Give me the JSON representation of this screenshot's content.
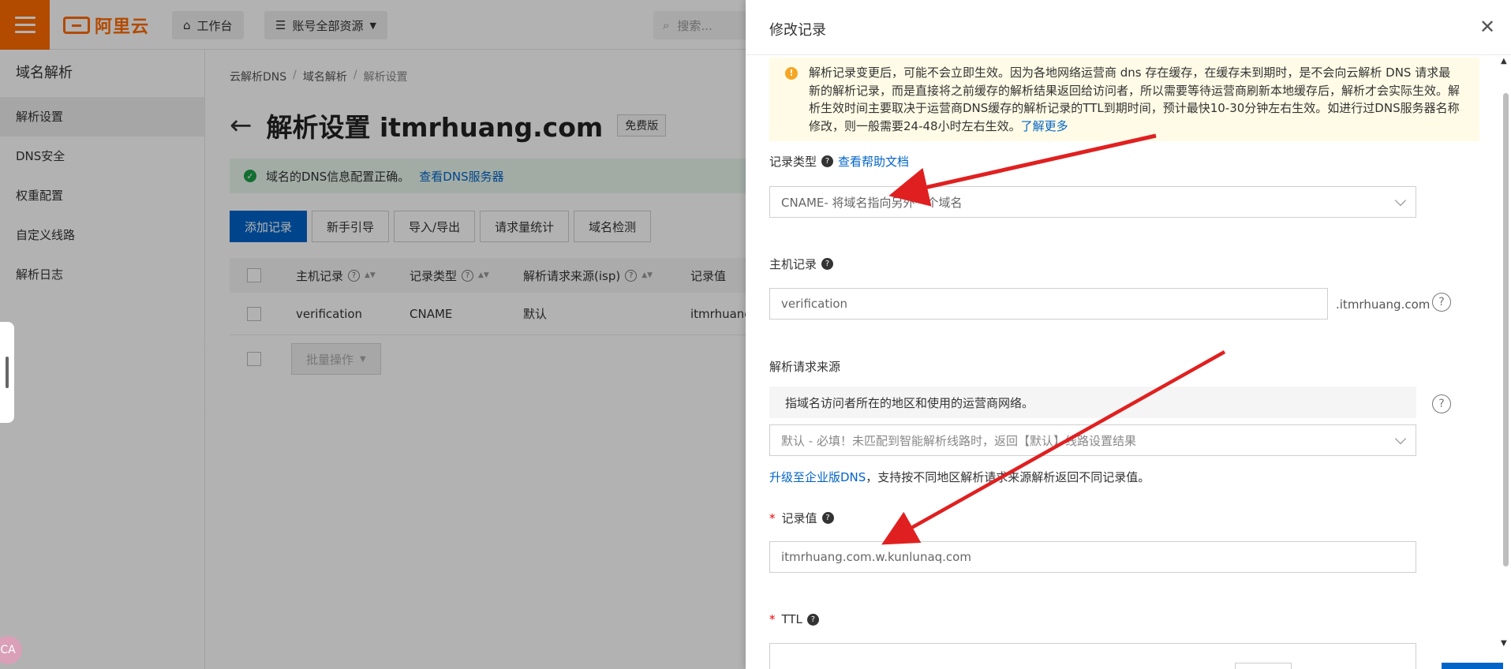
{
  "topbar": {
    "logo_text": "阿里云",
    "workbench_label": "工作台",
    "resources_label": "账号全部资源",
    "search_placeholder": "搜索..."
  },
  "sidenav": {
    "title": "域名解析",
    "items": [
      {
        "label": "解析设置",
        "active": true
      },
      {
        "label": "DNS安全",
        "active": false
      },
      {
        "label": "权重配置",
        "active": false
      },
      {
        "label": "自定义线路",
        "active": false
      },
      {
        "label": "解析日志",
        "active": false
      }
    ]
  },
  "main": {
    "breadcrumb": [
      "云解析DNS",
      "域名解析",
      "解析设置"
    ],
    "title": "解析设置 itmrhuang.com",
    "badge": "免费版",
    "dns_status": {
      "text": "域名的DNS信息配置正确。",
      "link": "查看DNS服务器"
    },
    "toolbar": [
      "添加记录",
      "新手引导",
      "导入/导出",
      "请求量统计",
      "域名检测"
    ],
    "table": {
      "columns": [
        "主机记录",
        "记录类型",
        "解析请求来源(isp)",
        "记录值"
      ],
      "rows": [
        {
          "host": "verification",
          "type": "CNAME",
          "source": "默认",
          "value": "itmrhuang."
        }
      ],
      "batch_label": "批量操作"
    }
  },
  "corner_avatar_text": "CA",
  "drawer": {
    "title": "修改记录",
    "notice": {
      "text": "解析记录变更后，可能不会立即生效。因为各地网络运营商 dns 存在缓存，在缓存未到期时，是不会向云解析 DNS 请求最新的解析记录，而是直接将之前缓存的解析结果返回给访问者，所以需要等待运营商刷新本地缓存后，解析才会实际生效。解析生效时间主要取决于运营商DNS缓存的解析记录的TTL到期时间，预计最快10-30分钟左右生效。如进行过DNS服务器名称修改，则一般需要24-48小时左右生效。",
      "link": "了解更多"
    },
    "record_type": {
      "label": "记录类型",
      "help_link": "查看帮助文档",
      "value": "CNAME- 将域名指向另外一个域名"
    },
    "host": {
      "label": "主机记录",
      "value": "verification",
      "suffix": ".itmrhuang.com"
    },
    "source": {
      "label": "解析请求来源",
      "hint": "指域名访问者所在的地区和使用的运营商网络。",
      "value": "默认 - 必填！未匹配到智能解析线路时，返回【默认】线路设置结果",
      "upgrade_link": "升级至企业版DNS",
      "upgrade_text": "，支持按不同地区解析请求来源解析返回不同记录值。"
    },
    "record_value": {
      "label": "记录值",
      "value": "itmrhuang.com.w.kunlunaq.com"
    },
    "ttl": {
      "label": "TTL"
    }
  },
  "colors": {
    "brand": "#ff6a00",
    "primary": "#0064c8",
    "success": "#1e9e47",
    "warning_bg": "#fffbe6",
    "arrow": "#e02020"
  }
}
